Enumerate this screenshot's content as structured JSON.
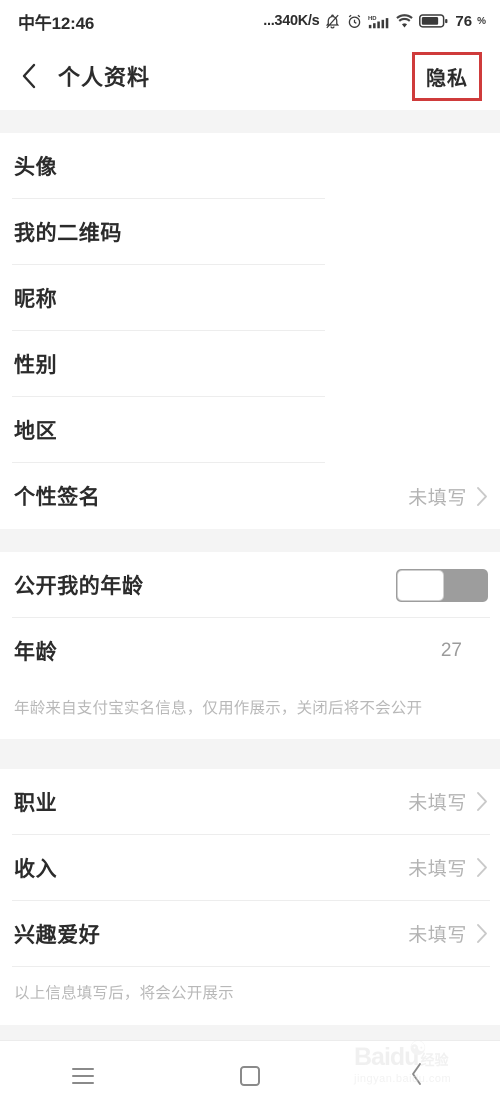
{
  "status_bar": {
    "time": "中午12:46",
    "net_speed": "...340K/s",
    "icons": [
      "bell-muted-icon",
      "alarm-icon",
      "hd-signal-icon",
      "wifi-icon",
      "battery-icon"
    ],
    "battery_percent": "76",
    "percent_sign": "%"
  },
  "header": {
    "back_icon": "back-chevron-icon",
    "title": "个人资料",
    "action_label": "隐私",
    "annotation_color": "#cf3b3b"
  },
  "groups": [
    {
      "rows": [
        {
          "label": "头像",
          "value": "",
          "chevron": false
        },
        {
          "label": "我的二维码",
          "value": "",
          "chevron": false
        },
        {
          "label": "昵称",
          "value": "",
          "chevron": false
        },
        {
          "label": "性别",
          "value": "",
          "chevron": false
        },
        {
          "label": "地区",
          "value": "",
          "chevron": false
        },
        {
          "label": "个性签名",
          "value": "未填写",
          "chevron": true
        }
      ]
    },
    {
      "rows": [
        {
          "label": "公开我的年龄",
          "toggle": "off"
        },
        {
          "label": "年龄",
          "value": "27",
          "chevron": false
        }
      ],
      "footnote": "年龄来自支付宝实名信息，仅用作展示，关闭后将不会公开"
    },
    {
      "rows": [
        {
          "label": "职业",
          "value": "未填写",
          "chevron": true
        },
        {
          "label": "收入",
          "value": "未填写",
          "chevron": true
        },
        {
          "label": "兴趣爱好",
          "value": "未填写",
          "chevron": true
        }
      ],
      "footnote": "以上信息填写后，将会公开展示"
    }
  ],
  "navbar": {
    "menu_icon": "hamburger-menu-icon",
    "home_icon": "square-home-icon",
    "back_icon": "back-chevron-icon"
  },
  "watermark": {
    "brand": "Baidu",
    "brand_cn": "经验",
    "url": "jingyan.baidu.com",
    "paw": "paw-icon"
  }
}
